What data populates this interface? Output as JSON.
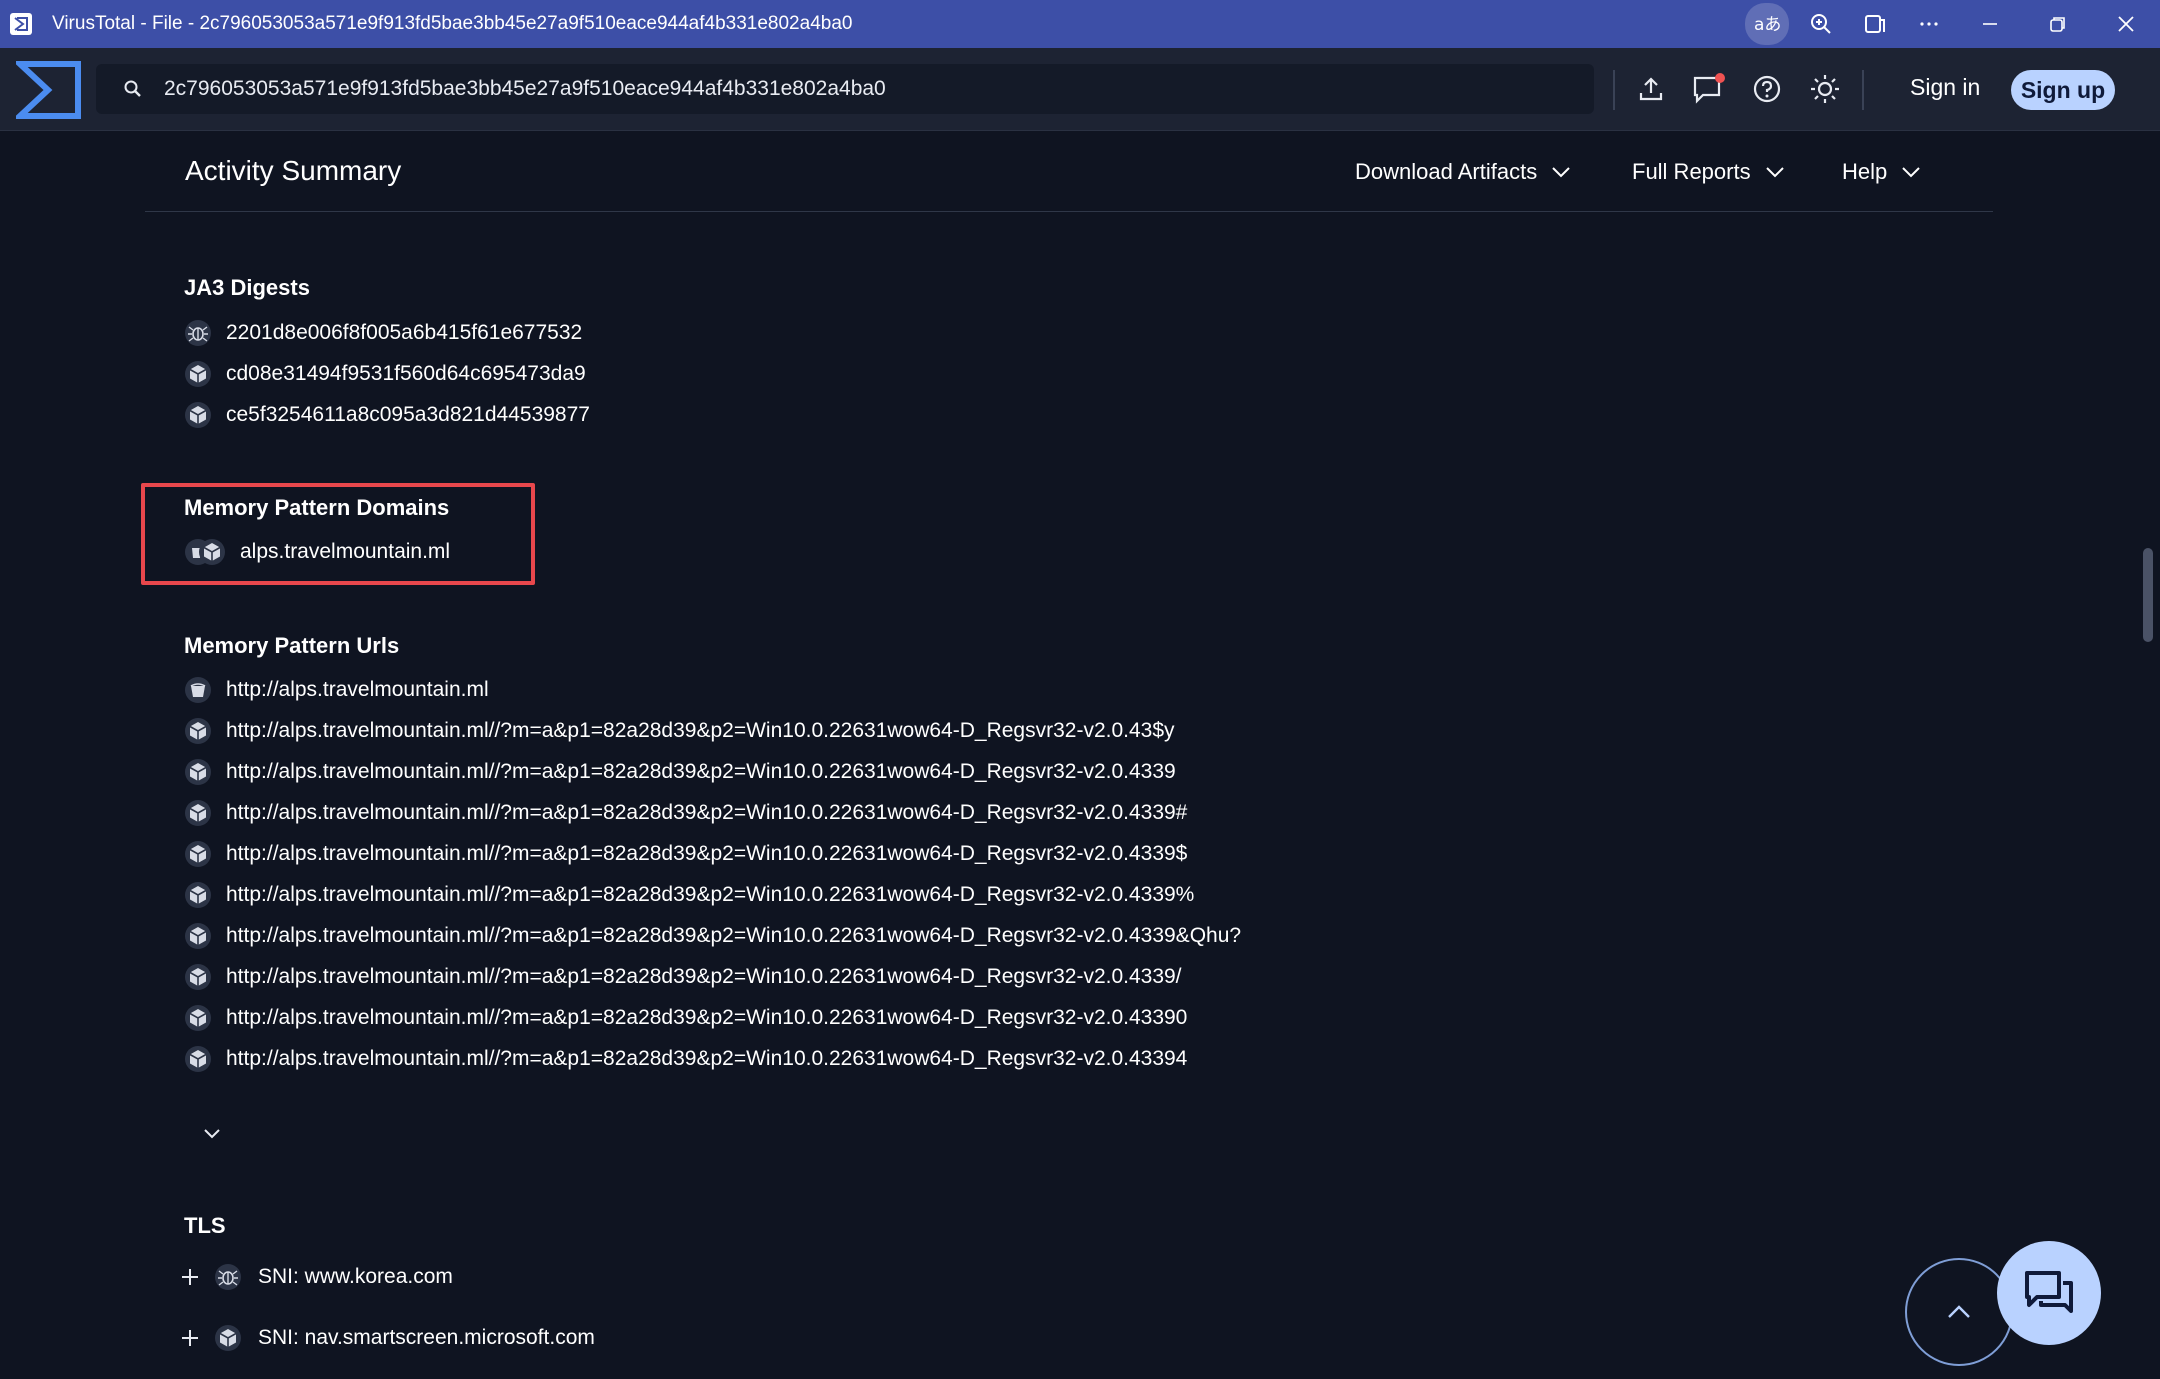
{
  "window": {
    "title": "VirusTotal - File - 2c796053053a571e9f913fd5bae3bb45e27a9f510eace944af4b331e802a4ba0"
  },
  "search": {
    "value": "2c796053053a571e9f913fd5bae3bb45e27a9f510eace944af4b331e802a4ba0"
  },
  "nav": {
    "sign_in": "Sign in",
    "sign_up": "Sign up"
  },
  "activity": {
    "title": "Activity Summary",
    "menus": [
      {
        "label": "Download Artifacts"
      },
      {
        "label": "Full Reports"
      },
      {
        "label": "Help"
      }
    ]
  },
  "ja3": {
    "title": "JA3 Digests",
    "items": [
      {
        "value": "2201d8e006f8f005a6b415f61e677532",
        "icon": "bug-icon"
      },
      {
        "value": "cd08e31494f9531f560d64c695473da9",
        "icon": "sandbox-box-icon"
      },
      {
        "value": "ce5f3254611a8c095a3d821d44539877",
        "icon": "sandbox-box-icon"
      }
    ]
  },
  "memory_domains": {
    "title": "Memory Pattern Domains",
    "items": [
      {
        "value": "alps.travelmountain.ml",
        "icon": "sandbox-pair-icon"
      }
    ]
  },
  "memory_urls": {
    "title": "Memory Pattern Urls",
    "items": [
      {
        "value": "http://alps.travelmountain.ml",
        "icon": "sandbox-cup-icon"
      },
      {
        "value": "http://alps.travelmountain.ml//?m=a&p1=82a28d39&p2=Win10.0.22631wow64-D_Regsvr32-v2.0.43$y",
        "icon": "sandbox-box-icon"
      },
      {
        "value": "http://alps.travelmountain.ml//?m=a&p1=82a28d39&p2=Win10.0.22631wow64-D_Regsvr32-v2.0.4339",
        "icon": "sandbox-box-icon"
      },
      {
        "value": "http://alps.travelmountain.ml//?m=a&p1=82a28d39&p2=Win10.0.22631wow64-D_Regsvr32-v2.0.4339#",
        "icon": "sandbox-box-icon"
      },
      {
        "value": "http://alps.travelmountain.ml//?m=a&p1=82a28d39&p2=Win10.0.22631wow64-D_Regsvr32-v2.0.4339$",
        "icon": "sandbox-box-icon"
      },
      {
        "value": "http://alps.travelmountain.ml//?m=a&p1=82a28d39&p2=Win10.0.22631wow64-D_Regsvr32-v2.0.4339%",
        "icon": "sandbox-box-icon"
      },
      {
        "value": "http://alps.travelmountain.ml//?m=a&p1=82a28d39&p2=Win10.0.22631wow64-D_Regsvr32-v2.0.4339&Qhu?",
        "icon": "sandbox-box-icon"
      },
      {
        "value": "http://alps.travelmountain.ml//?m=a&p1=82a28d39&p2=Win10.0.22631wow64-D_Regsvr32-v2.0.4339/",
        "icon": "sandbox-box-icon"
      },
      {
        "value": "http://alps.travelmountain.ml//?m=a&p1=82a28d39&p2=Win10.0.22631wow64-D_Regsvr32-v2.0.43390",
        "icon": "sandbox-box-icon"
      },
      {
        "value": "http://alps.travelmountain.ml//?m=a&p1=82a28d39&p2=Win10.0.22631wow64-D_Regsvr32-v2.0.43394",
        "icon": "sandbox-box-icon"
      }
    ]
  },
  "tls": {
    "title": "TLS",
    "items": [
      {
        "value": "SNI: www.korea.com",
        "icon": "bug-icon"
      },
      {
        "value": "SNI: nav.smartscreen.microsoft.com",
        "icon": "sandbox-box-icon"
      }
    ]
  },
  "colors": {
    "titlebar": "#3d4fa7",
    "nav": "#1d2333",
    "background": "#0f1421",
    "accent": "#b9d2ff",
    "highlight": "#e8474c"
  }
}
